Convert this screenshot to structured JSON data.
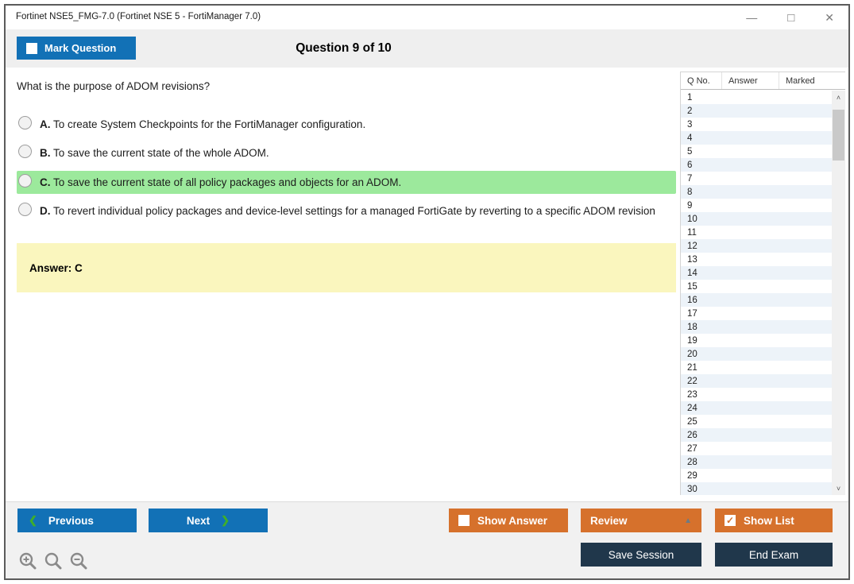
{
  "window": {
    "title": "Fortinet NSE5_FMG-7.0 (Fortinet NSE 5 - FortiManager 7.0)",
    "icons": {
      "minimize": "—",
      "maximize": "□",
      "close": "✕"
    }
  },
  "header": {
    "mark_question_label": "Mark Question",
    "mark_question_checked": false,
    "question_counter": "Question 9 of 10"
  },
  "question": {
    "text": "What is the purpose of ADOM revisions?",
    "options": [
      {
        "letter": "A.",
        "text": "To create System Checkpoints for the FortiManager configuration.",
        "highlighted": false
      },
      {
        "letter": "B.",
        "text": "To save the current state of the whole ADOM.",
        "highlighted": false
      },
      {
        "letter": "C.",
        "text": "To save the current state of all policy packages and objects for an ADOM.",
        "highlighted": true
      },
      {
        "letter": "D.",
        "text": "To revert individual policy packages and device-level settings for a managed FortiGate by reverting to a specific ADOM revision",
        "highlighted": false
      }
    ],
    "answer_label": "Answer: C"
  },
  "sidebar": {
    "columns": [
      "Q No.",
      "Answer",
      "Marked"
    ],
    "rows": [
      "1",
      "2",
      "3",
      "4",
      "5",
      "6",
      "7",
      "8",
      "9",
      "10",
      "11",
      "12",
      "13",
      "14",
      "15",
      "16",
      "17",
      "18",
      "19",
      "20",
      "21",
      "22",
      "23",
      "24",
      "25",
      "26",
      "27",
      "28",
      "29",
      "30"
    ],
    "scroll_up_glyph": "˄",
    "scroll_down_glyph": "˅"
  },
  "footer": {
    "previous_label": "Previous",
    "next_label": "Next",
    "show_answer_label": "Show Answer",
    "show_answer_checked": false,
    "review_label": "Review",
    "review_arrow_glyph": "▲",
    "show_list_label": "Show List",
    "show_list_checked": true,
    "check_glyph": "✓",
    "save_session_label": "Save Session",
    "end_exam_label": "End Exam",
    "prev_chevron_glyph": "❮",
    "next_chevron_glyph": "❯"
  },
  "colors": {
    "accent_blue": "#1271B6",
    "accent_orange": "#D6712C",
    "accent_navy": "#20374B",
    "highlight_green": "#9CE99C",
    "answer_yellow": "#FAF6BE",
    "chevron_green": "#3FAE2A",
    "alt_row_blue": "#EDF3F9"
  }
}
